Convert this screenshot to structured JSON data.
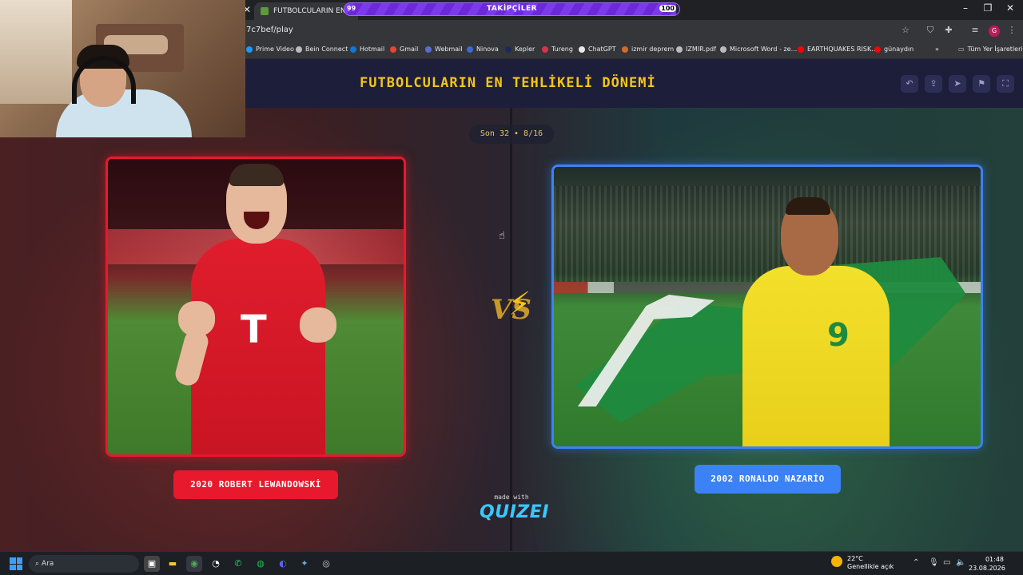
{
  "browser": {
    "tab_title": "FUTBOLCULARIN EN TEHLİ",
    "url": "7c7bef/play",
    "bookmarks": [
      "Prime Video",
      "Bein Connect",
      "Hotmail",
      "Gmail",
      "Webmail",
      "Ninova",
      "Kepler",
      "Tureng",
      "ChatGPT",
      "izmir deprem",
      "IZMIR.pdf",
      "Microsoft Word - ze...",
      "EARTHQUAKES RISK...",
      "günaydın"
    ],
    "all_bookmarks": "Tüm Yer İşaretleri",
    "profile_initial": "G"
  },
  "followers": {
    "label": "TAKİPÇİLER",
    "current": "99",
    "goal": "100",
    "progress": 0.99
  },
  "quiz": {
    "title": "FUTBOLCULARIN EN TEHLİKELİ DÖNEMİ",
    "round": "Son 32 • 8/16",
    "left_option": "2020 ROBERT LEWANDOWSKİ",
    "right_option": "2002 RONALDO NAZARİO",
    "vs": "VS",
    "made_with": "made with",
    "brand": "QUIZEI"
  },
  "taskbar": {
    "search_placeholder": "Ara",
    "temperature": "22°C",
    "weather": "Genellikle açık",
    "time": "01:48",
    "date": "23.08.2026"
  },
  "colors": {
    "accent_left": "#e8192c",
    "accent_right": "#3b82f6",
    "title": "#f5c518",
    "progress": "#7c3aed"
  }
}
